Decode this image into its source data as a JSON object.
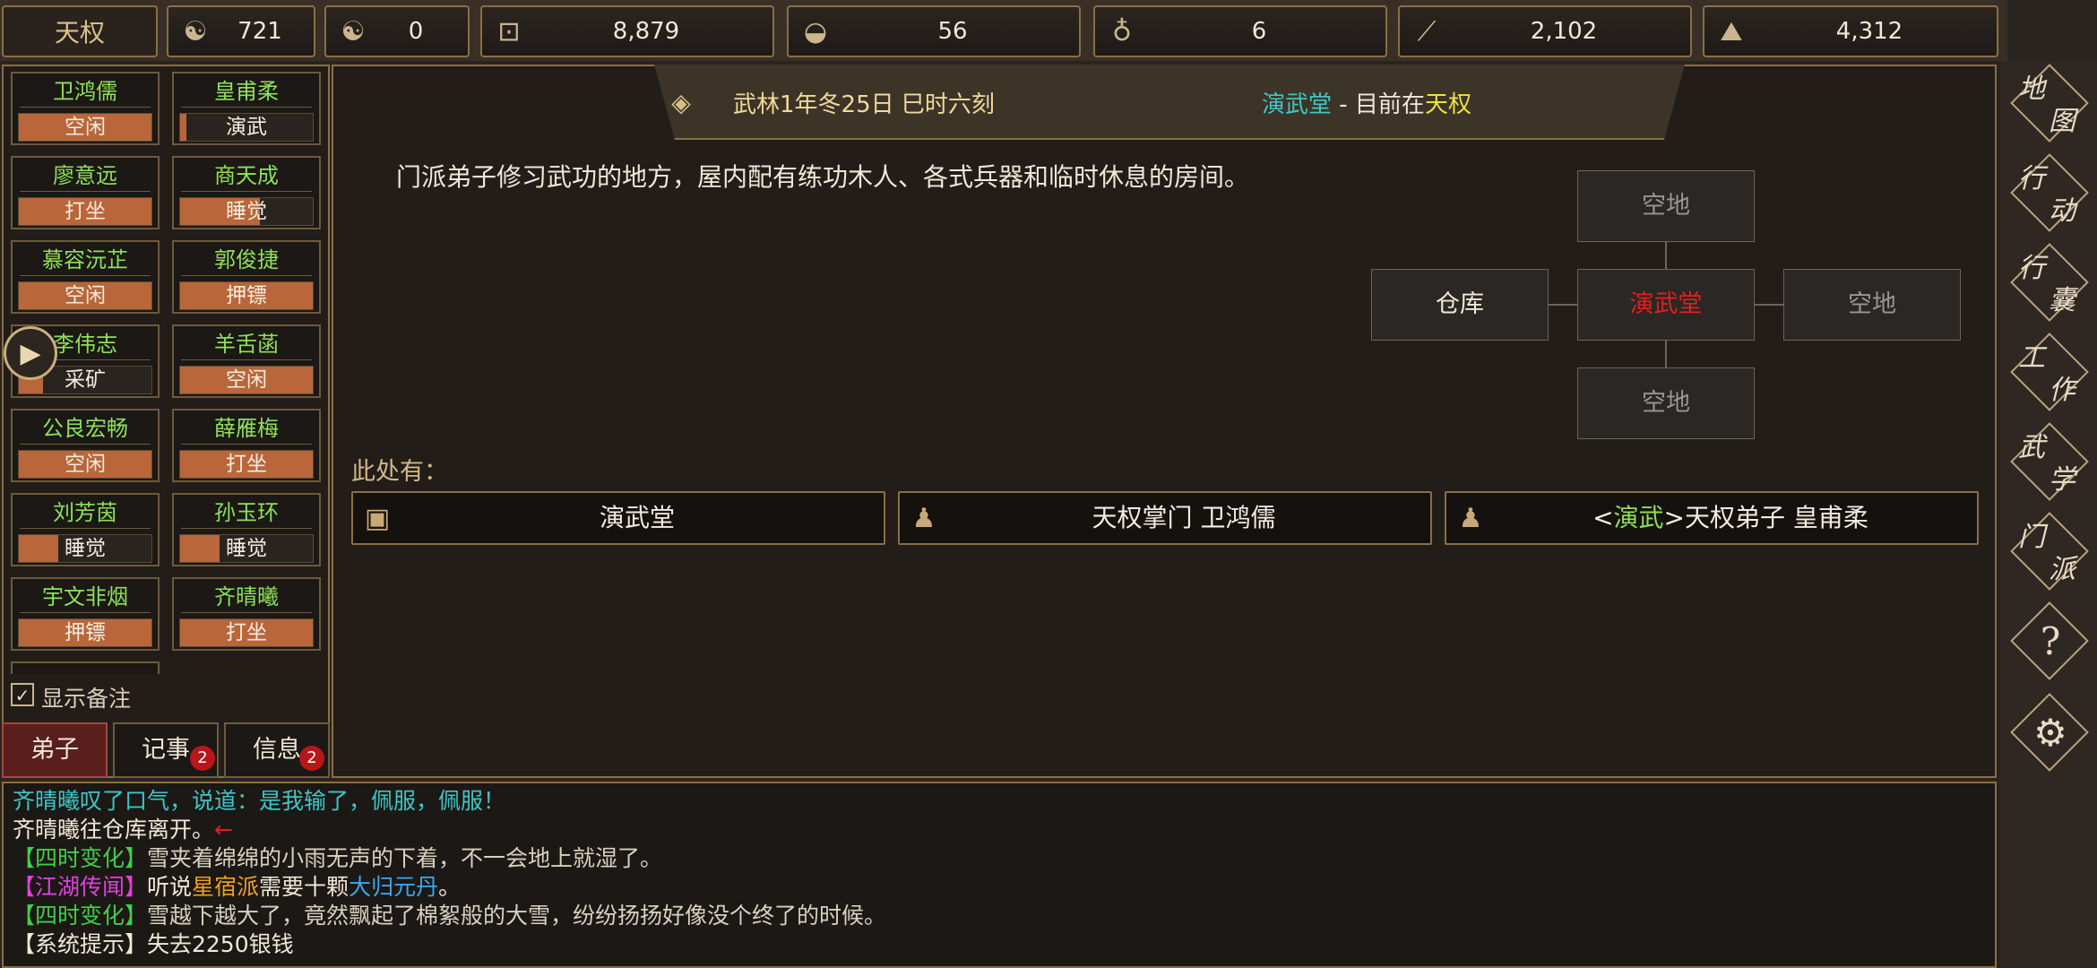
{
  "resources": {
    "sect": "天权",
    "fame": "721",
    "yinyang": "0",
    "money": "8,879",
    "food": "56",
    "herb": "6",
    "wood": "2,102",
    "ore": "4,312"
  },
  "disciples": [
    {
      "name": "卫鸿儒",
      "status": "空闲",
      "fill": 1.0
    },
    {
      "name": "皇甫柔",
      "status": "演武",
      "fill": 0.05
    },
    {
      "name": "廖意远",
      "status": "打坐",
      "fill": 1.0
    },
    {
      "name": "商天成",
      "status": "睡觉",
      "fill": 0.6
    },
    {
      "name": "慕容沅芷",
      "status": "空闲",
      "fill": 1.0
    },
    {
      "name": "郭俊捷",
      "status": "押镖",
      "fill": 1.0
    },
    {
      "name": "李伟志",
      "status": "采矿",
      "fill": 0.18
    },
    {
      "name": "羊舌菡",
      "status": "空闲",
      "fill": 1.0
    },
    {
      "name": "公良宏畅",
      "status": "空闲",
      "fill": 1.0
    },
    {
      "name": "薛雁梅",
      "status": "打坐",
      "fill": 1.0
    },
    {
      "name": "刘芳茵",
      "status": "睡觉",
      "fill": 0.3
    },
    {
      "name": "孙玉环",
      "status": "睡觉",
      "fill": 0.3
    },
    {
      "name": "宇文非烟",
      "status": "押镖",
      "fill": 1.0
    },
    {
      "name": "齐晴曦",
      "status": "打坐",
      "fill": 1.0
    }
  ],
  "show_notes": "显示备注",
  "tabs": {
    "disciples": "弟子",
    "journal": "记事",
    "journal_badge": "2",
    "info": "信息",
    "info_badge": "2"
  },
  "header": {
    "date": "武林1年冬25日 巳时六刻",
    "location": "演武堂",
    "sep": " - 目前在",
    "current": "天权"
  },
  "description": "门派弟子修习武功的地方，屋内配有练功木人、各式兵器和临时休息的房间。",
  "map": {
    "north": "空地",
    "west": "仓库",
    "center": "演武堂",
    "east": "空地",
    "south": "空地"
  },
  "here_label": "此处有：",
  "items": [
    {
      "icon": "box-icon",
      "text": "演武堂"
    },
    {
      "icon": "person-icon",
      "text": "天权掌门 卫鸿儒"
    },
    {
      "icon": "person-icon",
      "prefix": "<",
      "tag": "演武",
      "suffix": ">天权弟子 皇甫柔"
    }
  ],
  "menu": [
    "地图",
    "行动",
    "行囊",
    "工作",
    "武学",
    "门派"
  ],
  "log": [
    [
      {
        "t": "齐晴曦叹了口气，说道：是我输了，佩服，佩服！",
        "c": "#3ec6c6"
      }
    ],
    [
      {
        "t": "齐晴曦往仓库离开。",
        "c": "#f0e8d8"
      },
      {
        "t": "←",
        "c": "#e02020"
      }
    ],
    [
      {
        "t": "【四时变化】",
        "c": "#3ed04a"
      },
      {
        "t": "雪夹着绵绵的小雨无声的下着，不一会地上就湿了。",
        "c": "#d8d0c0"
      }
    ],
    [
      {
        "t": "【江湖传闻】",
        "c": "#e040e0"
      },
      {
        "t": "听说",
        "c": "#f0e8d8"
      },
      {
        "t": "星宿派",
        "c": "#f0a020"
      },
      {
        "t": "需要十颗",
        "c": "#f0e8d8"
      },
      {
        "t": "大归元丹",
        "c": "#3aa8f0"
      },
      {
        "t": "。",
        "c": "#f0e8d8"
      }
    ],
    [
      {
        "t": "【四时变化】",
        "c": "#3ed04a"
      },
      {
        "t": "雪越下越大了，竟然飘起了棉絮般的大雪，纷纷扬扬好像没个终了的时候。",
        "c": "#d8d0c0"
      }
    ],
    [
      {
        "t": "【系统提示】失去2250银钱",
        "c": "#f0e8d8"
      }
    ]
  ],
  "colors": {
    "accent_border": "#8a6f44",
    "name_green": "#8fe05a",
    "status_fill": "#b8663a",
    "location_cyan": "#3ec6c6",
    "current_yellow": "#f0e040",
    "center_red": "#e02020"
  }
}
